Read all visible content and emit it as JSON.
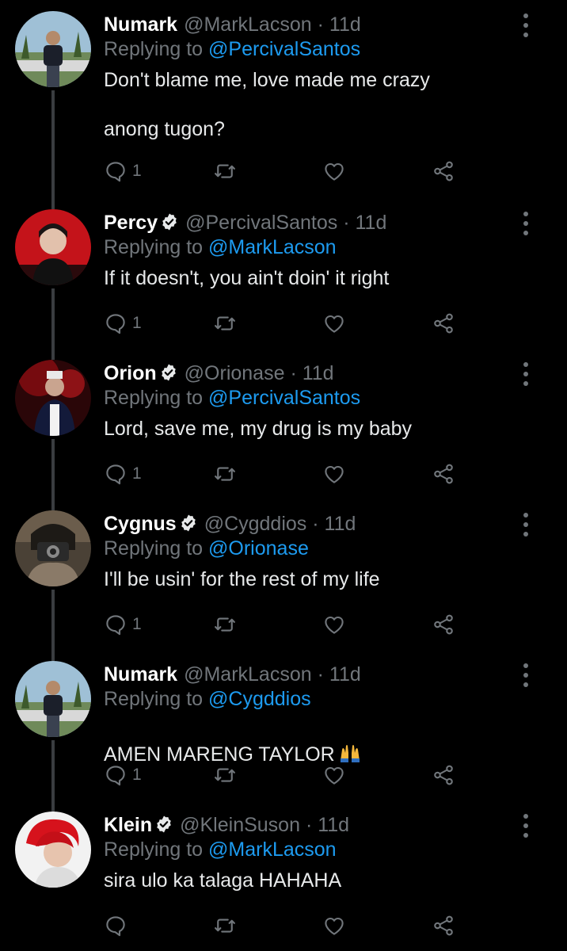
{
  "thread": {
    "tweets": [
      {
        "name": "Numark",
        "verified": false,
        "handle": "@MarkLacson",
        "dot": "·",
        "time": "11d",
        "replying_prefix": "Replying to",
        "replying_to": "@PercivalSantos",
        "text": "Don't blame me, love made me crazy\n\nanong tugon?",
        "reply_count": "1",
        "avatar": "outdoor-photo-man-palm-trees",
        "emoji": ""
      },
      {
        "name": "Percy",
        "verified": true,
        "handle": "@PercivalSantos",
        "dot": "·",
        "time": "11d",
        "replying_prefix": "Replying to",
        "replying_to": "@MarkLacson",
        "text": "If it doesn't, you ain't doin' it right",
        "reply_count": "1",
        "avatar": "portrait-red-background",
        "emoji": ""
      },
      {
        "name": "Orion",
        "verified": true,
        "handle": "@Orionase",
        "dot": "·",
        "time": "11d",
        "replying_prefix": "Replying to",
        "replying_to": "@PercivalSantos",
        "text": "Lord, save me, my drug is my baby",
        "reply_count": "1",
        "avatar": "stage-singer-red-light",
        "emoji": ""
      },
      {
        "name": "Cygnus",
        "verified": true,
        "handle": "@Cygddios",
        "dot": "·",
        "time": "11d",
        "replying_prefix": "Replying to",
        "replying_to": "@Orionase",
        "text": "I'll be usin' for the rest of my life",
        "reply_count": "1",
        "avatar": "person-holding-camera",
        "emoji": ""
      },
      {
        "name": "Numark",
        "verified": false,
        "handle": "@MarkLacson",
        "dot": "·",
        "time": "11d",
        "replying_prefix": "Replying to",
        "replying_to": "@Cygddios",
        "text": "AMEN MARENG TAYLOR",
        "reply_count": "1",
        "avatar": "outdoor-photo-man-palm-trees",
        "emoji": "raising-hands-emoji"
      },
      {
        "name": "Klein",
        "verified": true,
        "handle": "@KleinSuson",
        "dot": "·",
        "time": "11d",
        "replying_prefix": "Replying to",
        "replying_to": "@MarkLacson",
        "text": "sira ulo ka talaga HAHAHA",
        "reply_count": "",
        "avatar": "red-hair-portrait",
        "emoji": ""
      }
    ]
  },
  "colors": {
    "background": "#000000",
    "text": "#e7e9ea",
    "secondary": "#71767b",
    "mention": "#1d9bf0",
    "thread_line": "#3a3d40"
  },
  "icons": {
    "reply": "comment-bubble-icon",
    "retweet": "retweet-icon",
    "like": "heart-icon",
    "share": "share-icon",
    "more": "more-vertical-icon",
    "verified": "verified-badge-icon"
  }
}
